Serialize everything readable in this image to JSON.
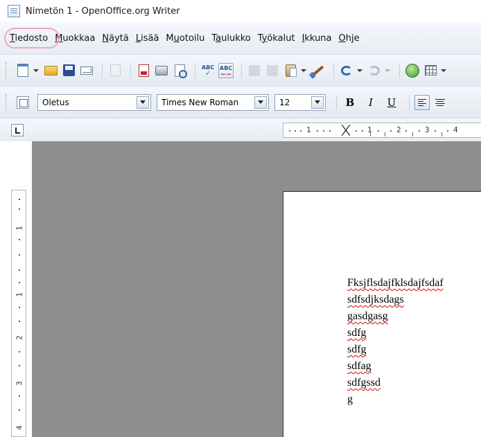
{
  "window": {
    "title": "Nimetön 1 - OpenOffice.org Writer",
    "icon": "writer-document-icon"
  },
  "menubar": {
    "items": [
      {
        "label": "Tiedosto",
        "mnemonic": "T"
      },
      {
        "label": "Muokkaa",
        "mnemonic": "M"
      },
      {
        "label": "Näytä",
        "mnemonic": "N"
      },
      {
        "label": "Lisää",
        "mnemonic": "L"
      },
      {
        "label": "Muotoilu",
        "mnemonic": "u"
      },
      {
        "label": "Taulukko",
        "mnemonic": "a"
      },
      {
        "label": "Työkalut",
        "mnemonic": "y"
      },
      {
        "label": "Ikkuna",
        "mnemonic": "I"
      },
      {
        "label": "Ohje",
        "mnemonic": "O"
      }
    ],
    "highlight_color": "#f3a6c6"
  },
  "standard_toolbar": {
    "icons": [
      "new-document-icon",
      "open-folder-icon",
      "save-icon",
      "email-icon",
      "edit-file-icon",
      "export-pdf-icon",
      "print-icon",
      "page-preview-icon",
      "spellcheck-icon",
      "autospellcheck-icon",
      "cut-icon",
      "copy-icon",
      "paste-icon",
      "clone-formatting-icon",
      "undo-icon",
      "redo-icon",
      "navigator-icon",
      "table-icon"
    ],
    "spell_label": "ABC"
  },
  "formatting_toolbar": {
    "paragraph_style": "Oletus",
    "font_name": "Times New Roman",
    "font_size": "12",
    "bold_label": "B",
    "italic_label": "I",
    "underline_label": "U"
  },
  "ruler": {
    "horizontal_labels": [
      "1",
      "1",
      "2",
      "3",
      "4"
    ],
    "vertical_labels": [
      "1",
      "1",
      "2",
      "3",
      "4"
    ]
  },
  "document": {
    "lines": [
      "Fksjflsdajfklsdajfsdaf",
      "sdfsdjksdags",
      "gasdgasg",
      "sdfg",
      "sdfg",
      "sdfag",
      "sdfgssd",
      "g"
    ],
    "spelling_error_color": "#e00000"
  }
}
